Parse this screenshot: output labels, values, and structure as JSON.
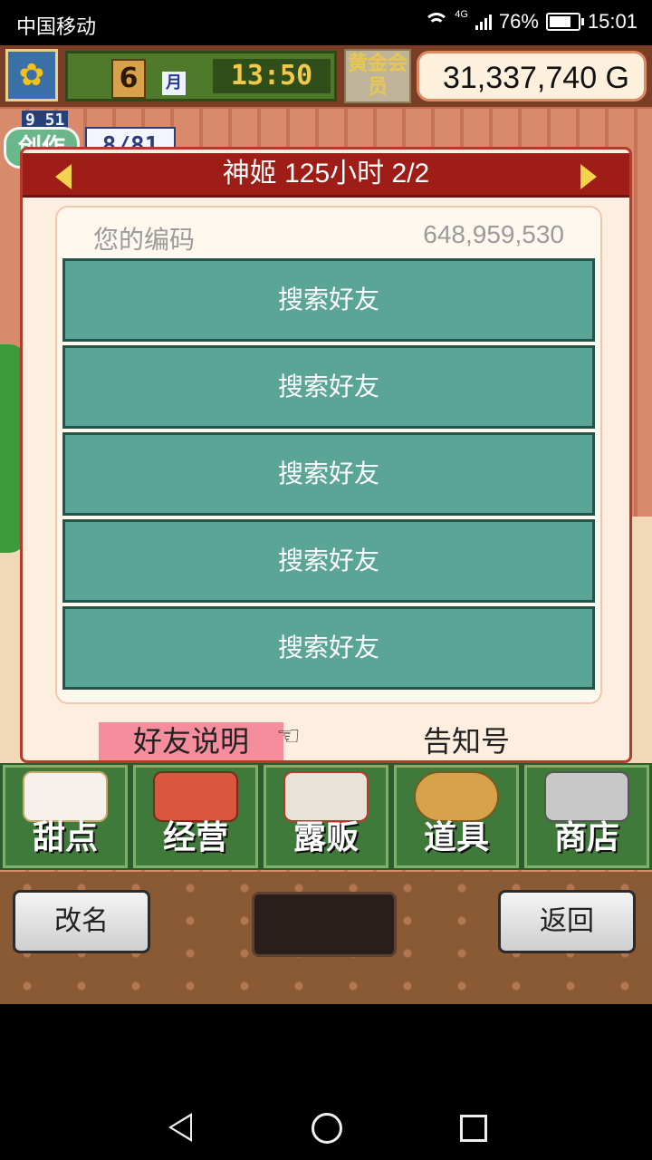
{
  "status_bar": {
    "carrier": "中国移动",
    "network": "4G",
    "battery": "76%",
    "time": "15:01"
  },
  "top_bar": {
    "month_number": "6",
    "month_label": "月",
    "clock": "13:50",
    "membership": "黄金会员",
    "money": "31,337,740 G"
  },
  "craft": {
    "timer": "9 51",
    "label": "创作",
    "count": "8/81"
  },
  "dialog": {
    "title": "神姬  125小时 2/2",
    "code_label": "您的编码",
    "code_value": "648,959,530",
    "search_buttons": [
      "搜索好友",
      "搜索好友",
      "搜索好友",
      "搜索好友",
      "搜索好友"
    ],
    "tab_friends": "好友说明",
    "tab_notice": "告知号"
  },
  "menu": {
    "items": [
      "甜点",
      "经营",
      "露贩",
      "道具",
      "商店"
    ]
  },
  "footer": {
    "rename": "改名",
    "back": "返回"
  }
}
